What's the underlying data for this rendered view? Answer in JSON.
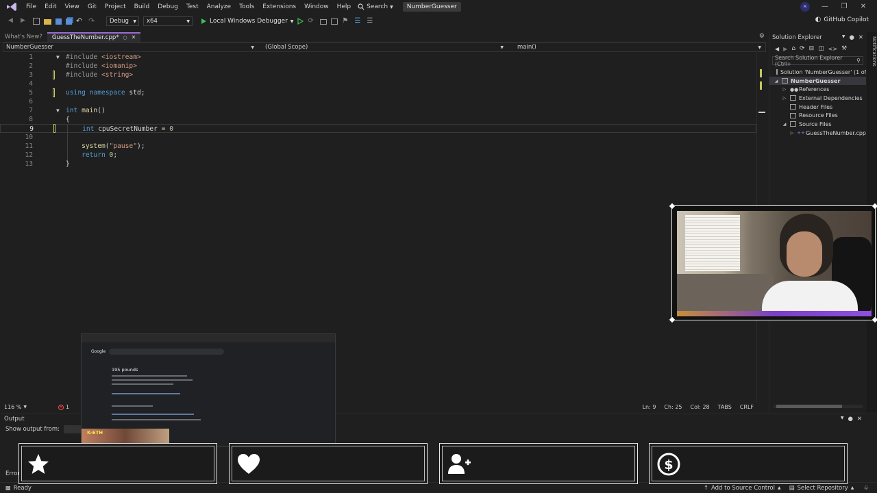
{
  "titlebar": {
    "menu": [
      "File",
      "Edit",
      "View",
      "Git",
      "Project",
      "Build",
      "Debug",
      "Test",
      "Analyze",
      "Tools",
      "Extensions",
      "Window",
      "Help"
    ],
    "search_label": "Search",
    "solution_name": "NumberGuesser",
    "avatar_initial": "R"
  },
  "toolbar": {
    "config": "Debug",
    "platform": "x64",
    "run_label": "Local Windows Debugger",
    "copilot_label": "GitHub Copilot"
  },
  "doc_tabs": {
    "whats_new": "What's New?",
    "active": "GuessTheNumber.cpp*"
  },
  "navbar": {
    "project": "NumberGuesser",
    "scope": "(Global Scope)",
    "member": "main()"
  },
  "code_lines": [
    {
      "n": "1",
      "text": "#include <iostream>"
    },
    {
      "n": "2",
      "text": "#include <iomanip>"
    },
    {
      "n": "3",
      "text": "#include <string>"
    },
    {
      "n": "4",
      "text": ""
    },
    {
      "n": "5",
      "text": "using namespace std;"
    },
    {
      "n": "6",
      "text": ""
    },
    {
      "n": "7",
      "text": "int main()"
    },
    {
      "n": "8",
      "text": "{"
    },
    {
      "n": "9",
      "text": "    int cpuSecretNumber = 0"
    },
    {
      "n": "10",
      "text": ""
    },
    {
      "n": "11",
      "text": "    system(\"pause\");"
    },
    {
      "n": "12",
      "text": "    return 0;"
    },
    {
      "n": "13",
      "text": "}"
    }
  ],
  "editor_status": {
    "zoom": "116 %",
    "errors": "1",
    "line": "Ln: 9",
    "ch": "Ch: 25",
    "col": "Col: 28",
    "tabs": "TABS",
    "eol": "CRLF"
  },
  "solution_explorer": {
    "title": "Solution Explorer",
    "search_placeholder": "Search Solution Explorer (Ctrl+",
    "items": [
      {
        "label": "Solution 'NumberGuesser' (1 of",
        "level": 0,
        "icon": "solution-icon"
      },
      {
        "label": "NumberGuesser",
        "level": 1,
        "icon": "project-icon"
      },
      {
        "label": "References",
        "level": 2,
        "icon": "references-icon"
      },
      {
        "label": "External Dependencies",
        "level": 2,
        "icon": "folder-icon"
      },
      {
        "label": "Header Files",
        "level": 2,
        "icon": "folder-icon"
      },
      {
        "label": "Resource Files",
        "level": 2,
        "icon": "folder-icon"
      },
      {
        "label": "Source Files",
        "level": 2,
        "icon": "folder-icon"
      },
      {
        "label": "GuessTheNumber.cpp",
        "level": 3,
        "icon": "cpp-file-icon"
      }
    ]
  },
  "notifications_label": "Notifications",
  "output": {
    "title": "Output",
    "show_from_label": "Show output from:",
    "error_tab": "Error Li"
  },
  "statusbar": {
    "ready": "Ready",
    "source_control": "Add to Source Control",
    "select_repo": "Select Repository"
  },
  "popup": {
    "brand": "Google",
    "answer": "195 pounds",
    "thumb_text": "K-ETH"
  },
  "social_icons": [
    "star-icon",
    "heart-icon",
    "add-user-icon",
    "dollar-icon"
  ],
  "colors": {
    "accent": "#9d6cd3",
    "keyword": "#569cd6",
    "string": "#d69d85",
    "function": "#dcdcaa",
    "number": "#b5cea8"
  }
}
